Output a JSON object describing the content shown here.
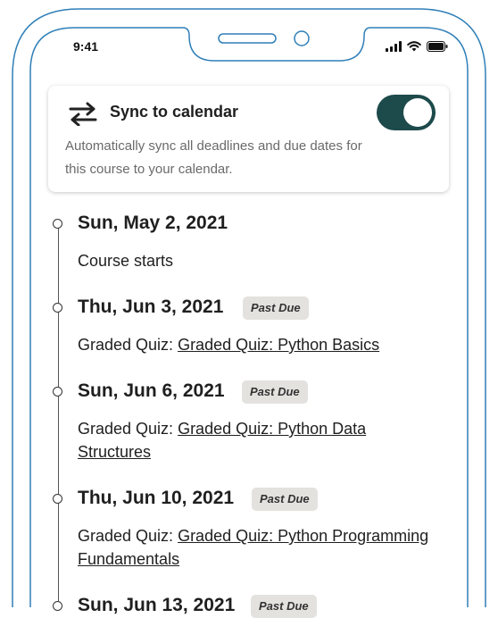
{
  "status_bar": {
    "time": "9:41"
  },
  "sync_card": {
    "title": "Sync to calendar",
    "description": "Automatically sync all deadlines and due dates for this course to your calendar.",
    "toggle_on": true,
    "toggle_color": "#1d4a4b"
  },
  "timeline": [
    {
      "date": "Sun, May 2, 2021",
      "badge": "",
      "prefix": "Course starts",
      "link": ""
    },
    {
      "date": "Thu, Jun 3, 2021",
      "badge": "Past Due",
      "prefix": "Graded Quiz: ",
      "link": "Graded Quiz: Python Basics"
    },
    {
      "date": "Sun, Jun 6, 2021",
      "badge": "Past Due",
      "prefix": "Graded Quiz: ",
      "link": "Graded Quiz: Python Data Structures"
    },
    {
      "date": "Thu, Jun 10, 2021",
      "badge": "Past Due",
      "prefix": "Graded Quiz: ",
      "link": "Graded Quiz: Python Programming Fundamentals"
    },
    {
      "date": "Sun, Jun 13, 2021",
      "badge": "Past Due",
      "prefix": "",
      "link": ""
    }
  ]
}
